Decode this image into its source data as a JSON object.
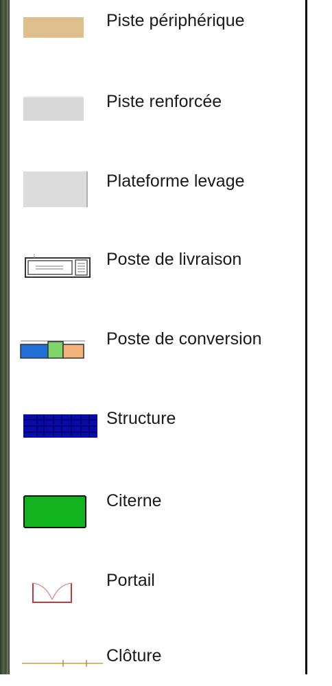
{
  "legend": {
    "items": [
      {
        "label": "Piste périphérique",
        "symbol": "peripheral-track-swatch",
        "color": "#ddc08e"
      },
      {
        "label": "Piste renforcée",
        "symbol": "reinforced-track-swatch",
        "color": "#d8d8d8"
      },
      {
        "label": "Plateforme levage",
        "symbol": "lifting-platform-swatch",
        "color": "#dcdcdc"
      },
      {
        "label": "Poste de livraison",
        "symbol": "delivery-station-icon",
        "color": "#333333"
      },
      {
        "label": "Poste de conversion",
        "symbol": "conversion-station-icon",
        "colors": [
          "#1f6fd6",
          "#7fd46a",
          "#f2b27a"
        ]
      },
      {
        "label": "Structure",
        "symbol": "structure-swatch",
        "color": "#0a0aa8"
      },
      {
        "label": "Citerne",
        "symbol": "tank-swatch",
        "color": "#11b31f"
      },
      {
        "label": "Portail",
        "symbol": "gate-icon",
        "color": "#c0393b"
      },
      {
        "label": "Clôture",
        "symbol": "fence-line-icon",
        "color": "#d9b66a"
      }
    ]
  }
}
